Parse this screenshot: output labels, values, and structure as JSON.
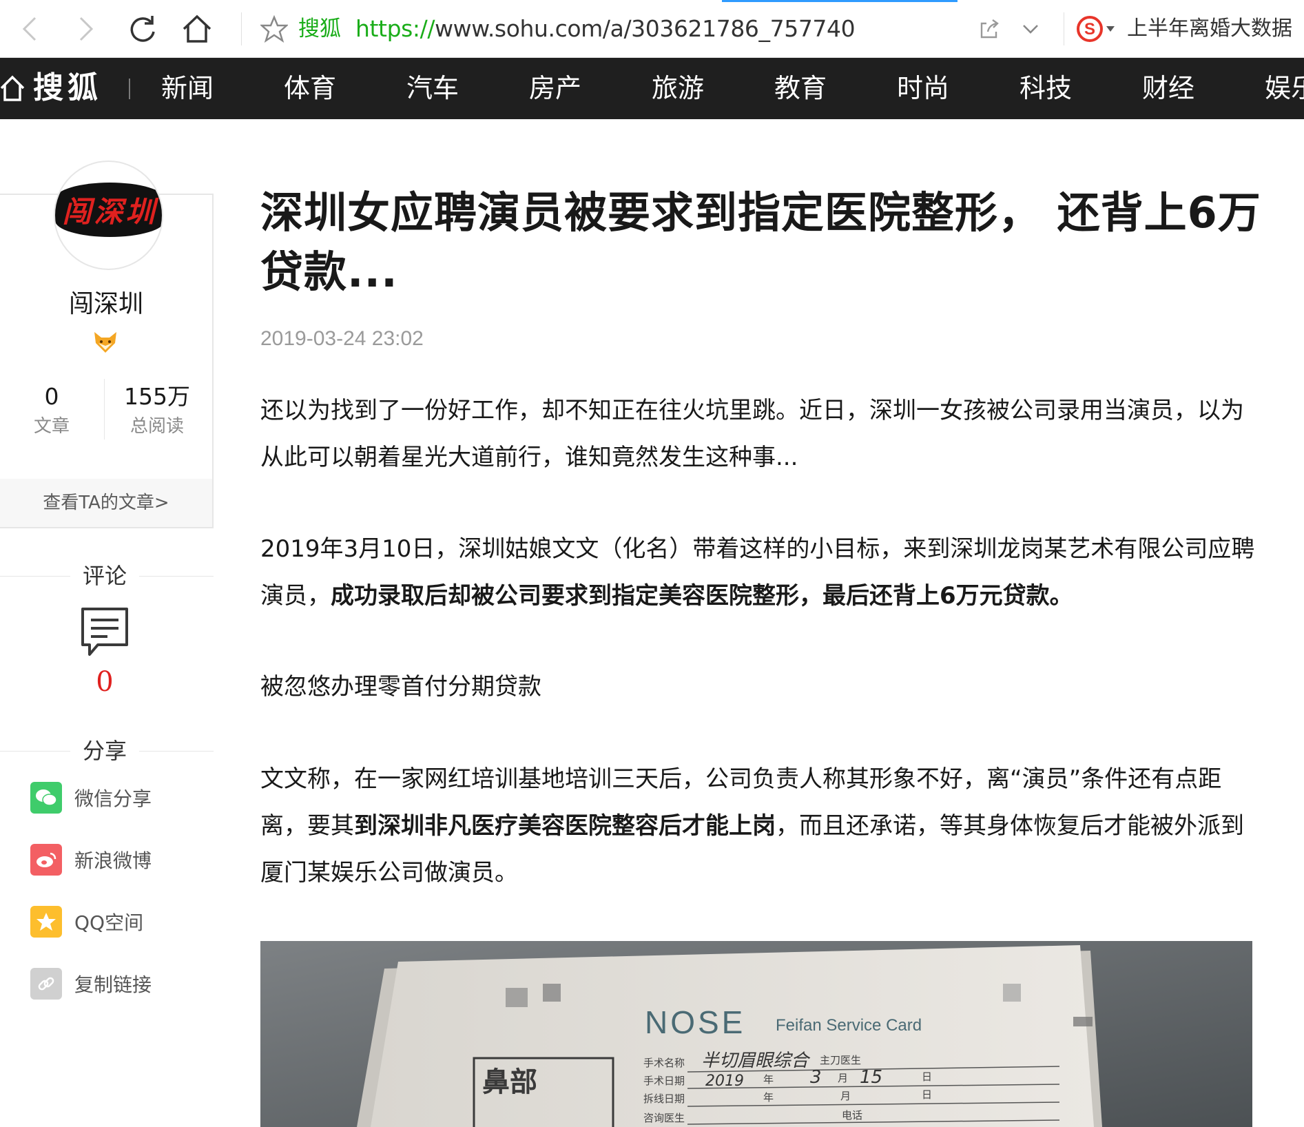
{
  "browser": {
    "site_label": "搜狐",
    "url_protocol": "https://",
    "url_rest": "www.sohu.com/a/303621786_757740",
    "hot_search": "上半年离婚大数据"
  },
  "site_nav": {
    "logo": "搜狐",
    "items": [
      "新闻",
      "体育",
      "汽车",
      "房产",
      "旅游",
      "教育",
      "时尚",
      "科技",
      "财经",
      "娱乐"
    ]
  },
  "author": {
    "avatar_text": "闯深圳",
    "name": "闯深圳",
    "articles_count": "0",
    "articles_label": "文章",
    "reads_count": "155万",
    "reads_label": "总阅读",
    "view_link": "查看TA的文章>"
  },
  "comments": {
    "label": "评论",
    "count": "0"
  },
  "share": {
    "label": "分享",
    "items": [
      {
        "label": "微信分享",
        "icon": "wechat-icon",
        "color": "#3fcc6b"
      },
      {
        "label": "新浪微博",
        "icon": "weibo-icon",
        "color": "#f35f63"
      },
      {
        "label": "QQ空间",
        "icon": "qzone-icon",
        "color": "#fdbe2d"
      },
      {
        "label": "复制链接",
        "icon": "link-icon",
        "color": "#d0d0d0"
      }
    ]
  },
  "article": {
    "title": "深圳女应聘演员被要求到指定医院整形，  还背上6万贷款...",
    "date": "2019-03-24 23:02",
    "p1": "还以为找到了一份好工作，却不知正在往火坑里跳。近日，深圳一女孩被公司录用当演员，以为从此可以朝着星光大道前行，谁知竟然发生这种事...",
    "p2_normal": "2019年3月10日，深圳姑娘文文（化名）带着这样的小目标，来到深圳龙岗某艺术有限公司应聘演员，",
    "p2_bold": "成功录取后却被公司要求到指定美容医院整形，最后还背上6万元贷款。",
    "p3": "被忽悠办理零首付分期贷款",
    "p4_a": "文文称，在一家网红培训基地培训三天后，公司负责人称其形象不好，离“演员”条件还有点距离，要其",
    "p4_bold": "到深圳非凡医疗美容医院整容后才能上岗",
    "p4_b": "，而且还承诺，等其身体恢复后才能被外派到厦门某娱乐公司做演员。"
  },
  "image_card": {
    "brand": "NOSE",
    "subtitle": "Feifan Service Card",
    "stamp": "鼻部",
    "row1_label": "手术名称",
    "row1_value": "半切眉眼综合",
    "row1_doctor": "主刀医生",
    "row2_label": "手术日期",
    "row2_year": "2019",
    "row2_nian": "年",
    "row2_month": "3",
    "row2_yue": "月",
    "row2_day": "15",
    "row2_ri": "日",
    "row3_label": "拆线日期",
    "row3_nian": "年",
    "row3_yue": "月",
    "row3_ri": "日",
    "row4_label": "咨询医生",
    "row4_phone": "电话"
  },
  "colors": {
    "brand_green": "#1aad19",
    "nav_bg": "#1f1f1f",
    "accent_red": "#e0211f"
  }
}
